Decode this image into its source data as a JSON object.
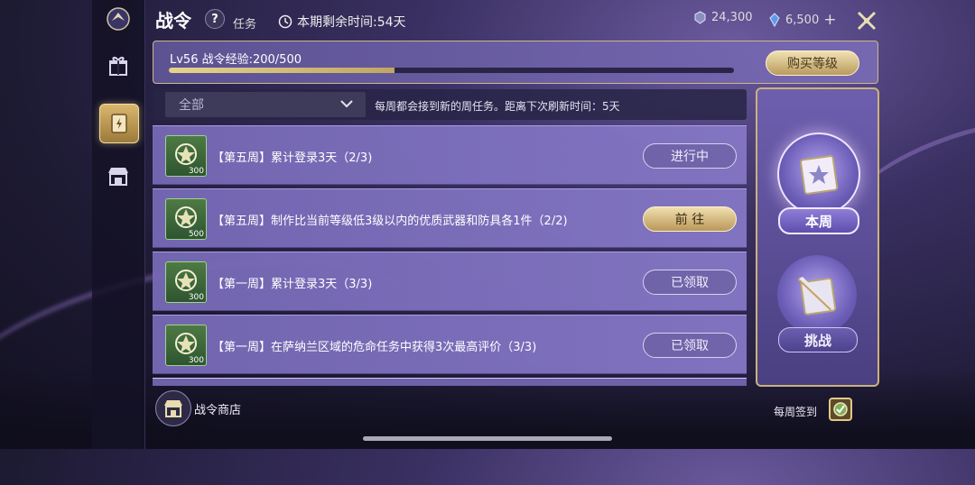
{
  "header": {
    "title": "战令",
    "help_icon": "question-mark",
    "subtitle": "任务",
    "timer_text": "本期剩余时间:54天",
    "currency_1": "24,300",
    "currency_2": "6,500",
    "plus": "+"
  },
  "exp": {
    "label": "Lv56 战令经验:200/500",
    "progress_fraction": 0.4,
    "buy_label": "购买等级"
  },
  "filter": {
    "selected": "全部",
    "notice": "每周都会接到新的周任务。距离下次刷新时间：5天"
  },
  "tasks": [
    {
      "amount": "300",
      "text": "【第五周】累计登录3天（2/3)",
      "button": "进行中",
      "state": "in-progress"
    },
    {
      "amount": "500",
      "text": "【第五周】制作比当前等级低3级以内的优质武器和防具各1件（2/2)",
      "button": "前 往",
      "state": "go"
    },
    {
      "amount": "300",
      "text": "【第一周】累计登录3天（3/3)",
      "button": "已领取",
      "state": "claimed"
    },
    {
      "amount": "300",
      "text": "【第一周】在萨纳兰区域的危命任务中获得3次最高评价（3/3)",
      "button": "已领取",
      "state": "claimed"
    }
  ],
  "shop": {
    "label": "战令商店"
  },
  "right_panel": {
    "this_week_label": "本周",
    "challenge_label": "挑战",
    "checkin_label": "每周签到"
  },
  "colors": {
    "gold": "#d9b76e",
    "task_bg": "#7668b4",
    "exp_fill": "#e6d38d"
  }
}
